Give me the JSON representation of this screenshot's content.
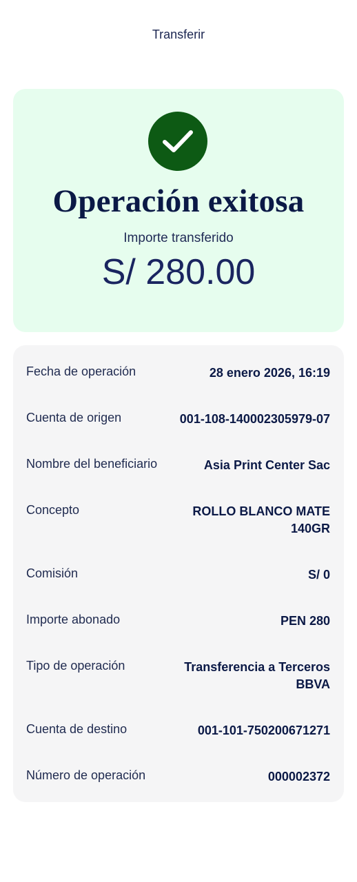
{
  "header": {
    "title": "Transferir"
  },
  "success": {
    "title": "Operación exitosa",
    "amount_label": "Importe transferido",
    "amount": "S/ 280.00",
    "icon": "checkmark-icon",
    "accent_color": "#0d5a14",
    "background_color": "#e6fdee"
  },
  "details": [
    {
      "label": "Fecha de operación",
      "value": "28 enero 2026, 16:19"
    },
    {
      "label": "Cuenta de origen",
      "value": "001-108-140002305979-07"
    },
    {
      "label": "Nombre del beneficiario",
      "value": "Asia Print Center Sac"
    },
    {
      "label": "Concepto",
      "value": "ROLLO BLANCO MATE 140GR"
    },
    {
      "label": "Comisión",
      "value": "S/ 0"
    },
    {
      "label": "Importe abonado",
      "value": "PEN 280"
    },
    {
      "label": "Tipo de operación",
      "value": "Transferencia a Terceros BBVA"
    },
    {
      "label": "Cuenta de destino",
      "value": "001-101-750200671271"
    },
    {
      "label": "Número de operación",
      "value": "000002372"
    }
  ]
}
